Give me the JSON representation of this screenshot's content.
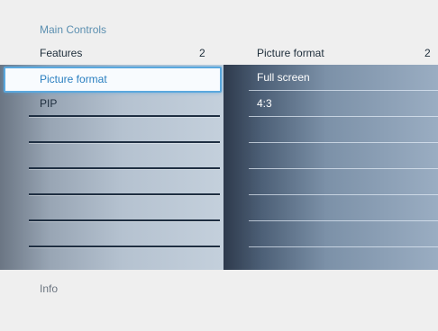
{
  "breadcrumb": "Main Controls",
  "left_panel": {
    "title": "Features",
    "count": "2",
    "items": [
      {
        "label": "Picture format",
        "selected": true
      },
      {
        "label": "PIP",
        "selected": false
      },
      {
        "label": "",
        "selected": false
      },
      {
        "label": "",
        "selected": false
      },
      {
        "label": "",
        "selected": false
      },
      {
        "label": "",
        "selected": false
      },
      {
        "label": "",
        "selected": false
      },
      {
        "label": "",
        "selected": false
      }
    ]
  },
  "right_panel": {
    "title": "Picture format",
    "count": "2",
    "items": [
      {
        "label": "Full screen"
      },
      {
        "label": "4:3"
      },
      {
        "label": ""
      },
      {
        "label": ""
      },
      {
        "label": ""
      },
      {
        "label": ""
      },
      {
        "label": ""
      },
      {
        "label": ""
      }
    ]
  },
  "info": {
    "label": "Info"
  },
  "colors": {
    "accent": "#2a7fc0",
    "selection_border": "#5aa8de",
    "background": "#efefef"
  }
}
